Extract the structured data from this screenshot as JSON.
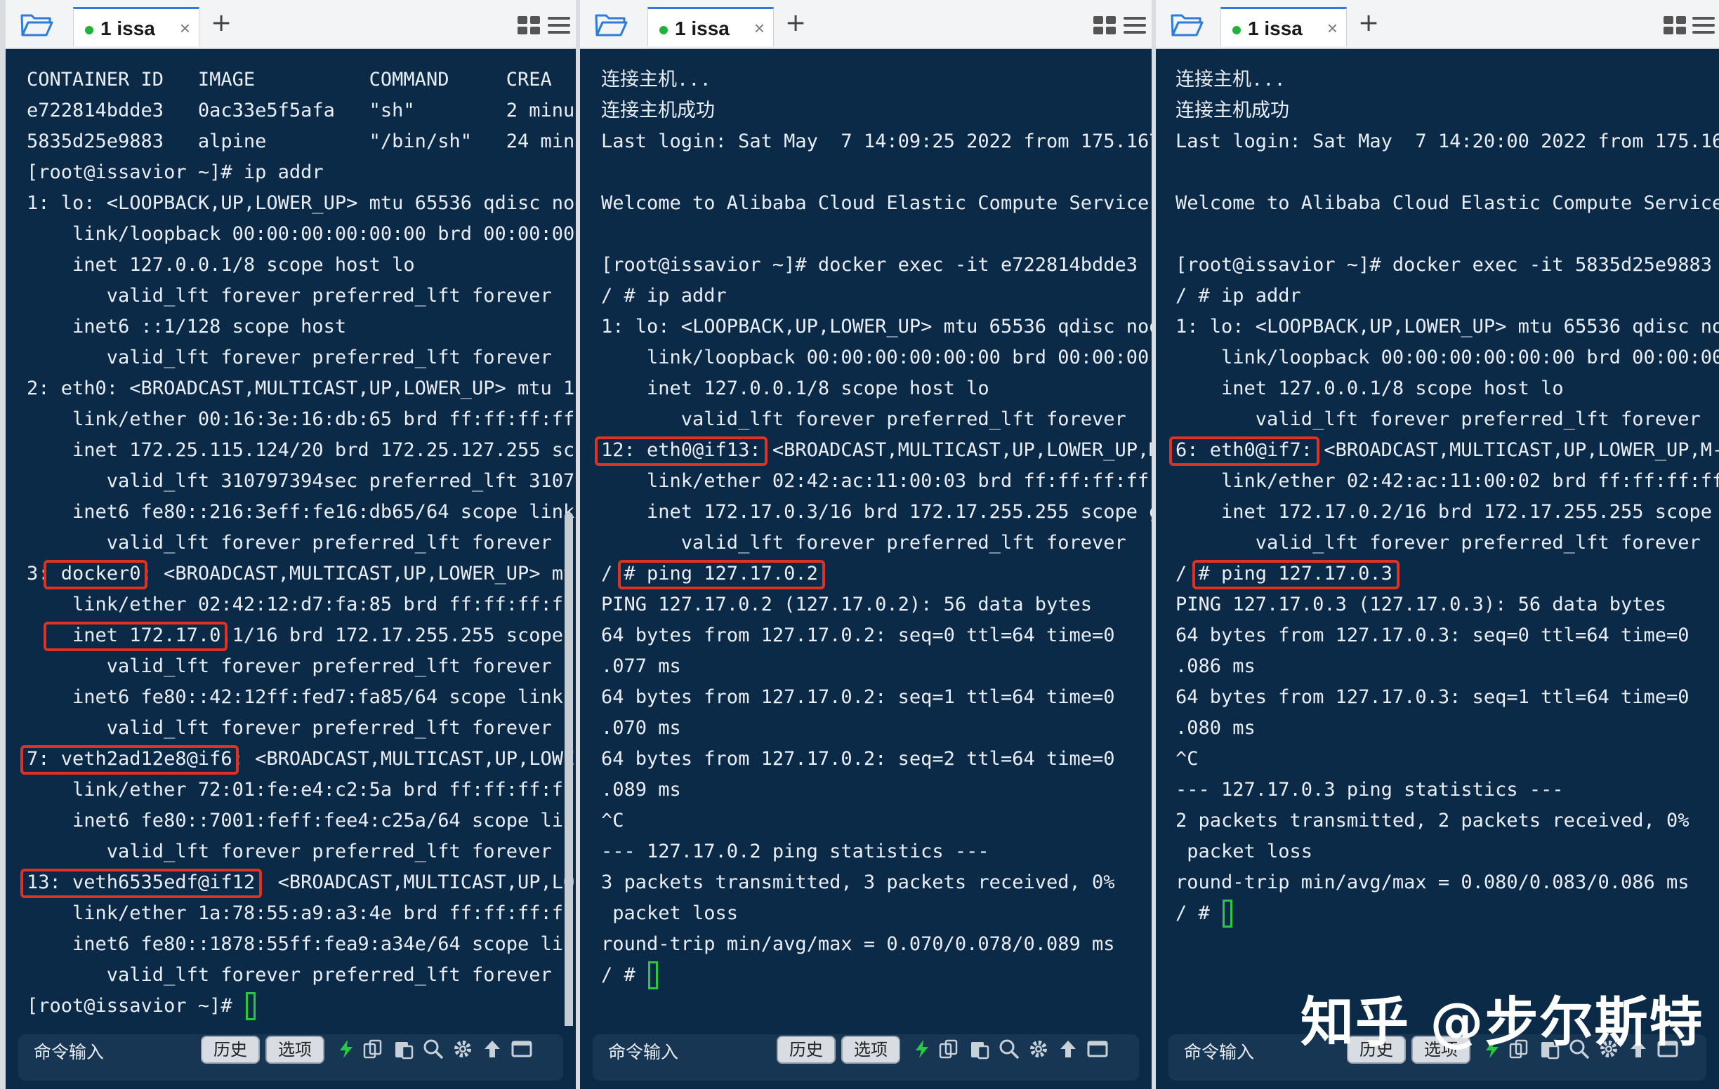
{
  "tab_label": "1 issa",
  "plus": "+",
  "close": "×",
  "bottom": {
    "cmd_input": "命令输入",
    "history": "历史",
    "options": "选项"
  },
  "watermark": "知乎 @步尔斯特",
  "colors": {
    "terminal_bg": "#0b2a47",
    "highlight": "#e03222",
    "cursor": "#28c840"
  },
  "pane1": {
    "lines": [
      "CONTAINER ID   IMAGE          COMMAND     CREA",
      "e722814bdde3   0ac33e5f5afa   \"sh\"        2 minut",
      "5835d25e9883   alpine         \"/bin/sh\"   24 minu",
      "[root@issavior ~]# ip addr",
      "1: lo: <LOOPBACK,UP,LOWER_UP> mtu 65536 qdisc noq",
      "    link/loopback 00:00:00:00:00:00 brd 00:00:00:",
      "    inet 127.0.0.1/8 scope host lo",
      "       valid_lft forever preferred_lft forever",
      "    inet6 ::1/128 scope host",
      "       valid_lft forever preferred_lft forever",
      "2: eth0: <BROADCAST,MULTICAST,UP,LOWER_UP> mtu 15",
      "    link/ether 00:16:3e:16:db:65 brd ff:ff:ff:ff:",
      "    inet 172.25.115.124/20 brd 172.25.127.255 sco",
      "       valid_lft 310797394sec preferred_lft 31079",
      "    inet6 fe80::216:3eff:fe16:db65/64 scope link",
      "       valid_lft forever preferred_lft forever",
      "3: docker0: <BROADCAST,MULTICAST,UP,LOWER_UP> mt",
      "    link/ether 02:42:12:d7:fa:85 brd ff:ff:ff:ff",
      "    inet 172.17.0.1/16 brd 172.17.255.255 scope",
      "       valid_lft forever preferred_lft forever",
      "    inet6 fe80::42:12ff:fed7:fa85/64 scope link",
      "       valid_lft forever preferred_lft forever",
      "7: veth2ad12e8@if6: <BROADCAST,MULTICAST,UP,LOWE",
      "    link/ether 72:01:fe:e4:c2:5a brd ff:ff:ff:ff",
      "    inet6 fe80::7001:feff:fee4:c25a/64 scope lin",
      "       valid_lft forever preferred_lft forever",
      "13: veth6535edf@if12: <BROADCAST,MULTICAST,UP,LO",
      "    link/ether 1a:78:55:a9:a3:4e brd ff:ff:ff:ff",
      "    inet6 fe80::1878:55ff:fea9:a34e/64 scope lin",
      "       valid_lft forever preferred_lft forever",
      "[root@issavior ~]# "
    ]
  },
  "pane2": {
    "lines": [
      "连接主机...",
      "连接主机成功",
      "Last login: Sat May  7 14:09:25 2022 from 175.167",
      "",
      "Welcome to Alibaba Cloud Elastic Compute Service",
      "",
      "[root@issavior ~]# docker exec -it e722814bdde3",
      "/ # ip addr",
      "1: lo: <LOOPBACK,UP,LOWER_UP> mtu 65536 qdisc noq",
      "    link/loopback 00:00:00:00:00:00 brd 00:00:00:",
      "    inet 127.0.0.1/8 scope host lo",
      "       valid_lft forever preferred_lft forever",
      "12: eth0@if13: <BROADCAST,MULTICAST,UP,LOWER_UP,M",
      "    link/ether 02:42:ac:11:00:03 brd ff:ff:ff:ff:",
      "    inet 172.17.0.3/16 brd 172.17.255.255 scope g",
      "       valid_lft forever preferred_lft forever",
      "/ # ping 127.17.0.2",
      "PING 127.17.0.2 (127.17.0.2): 56 data bytes",
      "64 bytes from 127.17.0.2: seq=0 ttl=64 time=0",
      ".077 ms",
      "64 bytes from 127.17.0.2: seq=1 ttl=64 time=0",
      ".070 ms",
      "64 bytes from 127.17.0.2: seq=2 ttl=64 time=0",
      ".089 ms",
      "^C",
      "--- 127.17.0.2 ping statistics ---",
      "3 packets transmitted, 3 packets received, 0%",
      " packet loss",
      "round-trip min/avg/max = 0.070/0.078/0.089 ms",
      "/ # "
    ]
  },
  "pane3": {
    "lines": [
      "连接主机...",
      "连接主机成功",
      "Last login: Sat May  7 14:20:00 2022 from 175.167",
      "",
      "Welcome to Alibaba Cloud Elastic Compute Service",
      "",
      "[root@issavior ~]# docker exec -it 5835d25e9883",
      "/ # ip addr",
      "1: lo: <LOOPBACK,UP,LOWER_UP> mtu 65536 qdisc noq",
      "    link/loopback 00:00:00:00:00:00 brd 00:00:00:",
      "    inet 127.0.0.1/8 scope host lo",
      "       valid_lft forever preferred_lft forever",
      "6: eth0@if7: <BROADCAST,MULTICAST,UP,LOWER_UP,M-D",
      "    link/ether 02:42:ac:11:00:02 brd ff:ff:ff:ff:",
      "    inet 172.17.0.2/16 brd 172.17.255.255 scope g",
      "       valid_lft forever preferred_lft forever",
      "/ # ping 127.17.0.3",
      "PING 127.17.0.3 (127.17.0.3): 56 data bytes",
      "64 bytes from 127.17.0.3: seq=0 ttl=64 time=0",
      ".086 ms",
      "64 bytes from 127.17.0.3: seq=1 ttl=64 time=0",
      ".080 ms",
      "^C",
      "--- 127.17.0.3 ping statistics ---",
      "2 packets transmitted, 2 packets received, 0%",
      " packet loss",
      "round-trip min/avg/max = 0.080/0.083/0.086 ms",
      "/ # "
    ]
  }
}
